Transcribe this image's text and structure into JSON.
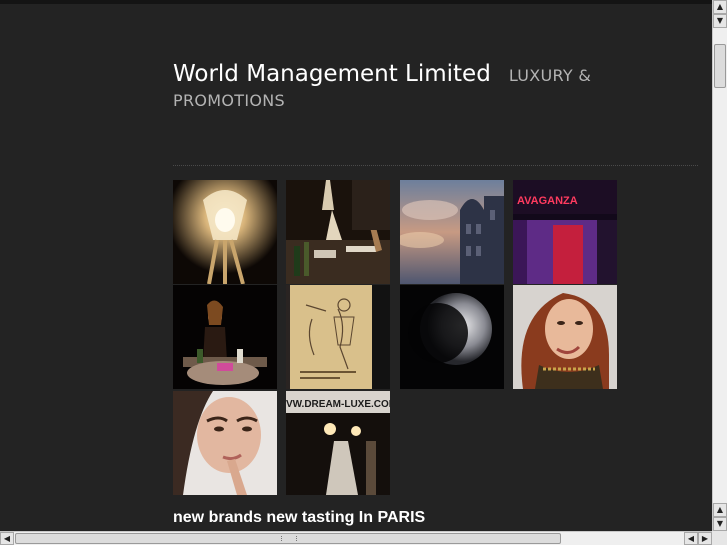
{
  "header": {
    "site_name": "World Management Limited",
    "tagline": "LUXURY & PROMOTIONS"
  },
  "gallery": {
    "thumbnails": [
      {
        "name": "photo-lamp-sculpture"
      },
      {
        "name": "photo-table-display"
      },
      {
        "name": "photo-cathedral-sky"
      },
      {
        "name": "photo-stage-extravaganza"
      },
      {
        "name": "photo-tasting-stand"
      },
      {
        "name": "photo-fashion-sketch"
      },
      {
        "name": "photo-moon-crescent"
      },
      {
        "name": "photo-smiling-woman"
      },
      {
        "name": "photo-woman-portrait"
      },
      {
        "name": "photo-dream-luxe-booth",
        "caption": "VW.DREAM-LUXE.COM"
      }
    ]
  },
  "post": {
    "title": "new brands new tasting In PARIS"
  },
  "scrollbars": {
    "up_arrow": "▲",
    "down_arrow": "▼",
    "left_arrow": "◀",
    "right_arrow": "▶"
  }
}
